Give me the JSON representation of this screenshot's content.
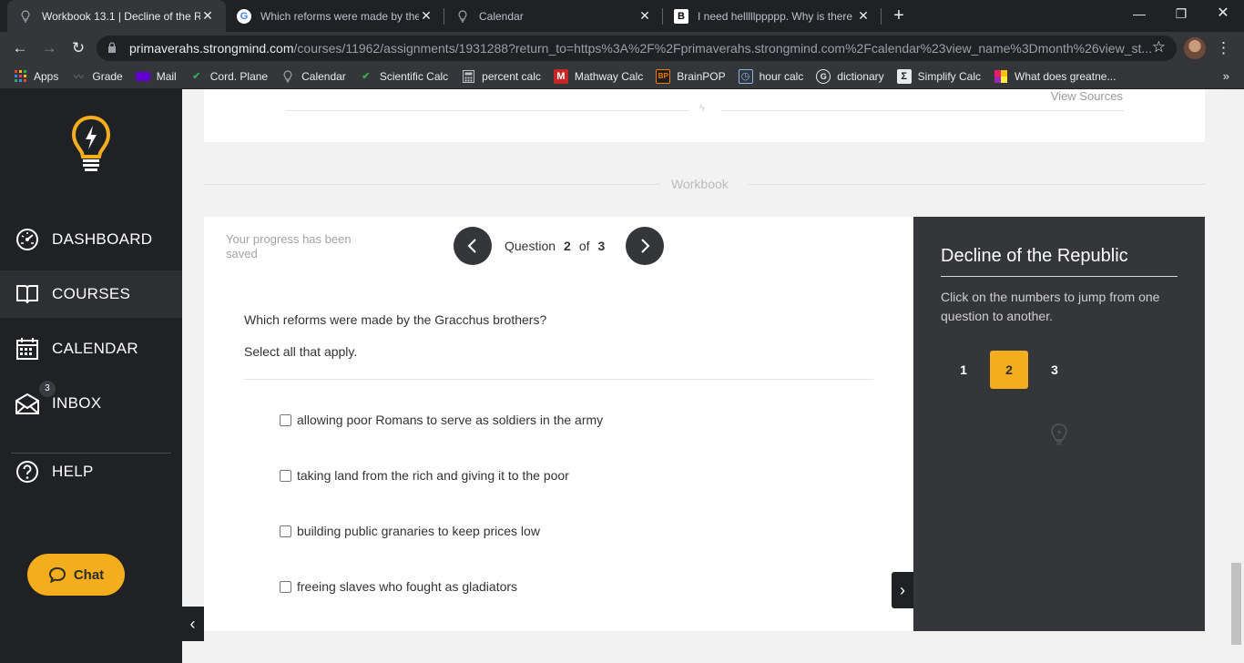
{
  "browser": {
    "tabs": [
      {
        "title": "Workbook 13.1 | Decline of the R",
        "icon": "lightbulb-icon",
        "active": true
      },
      {
        "title": "Which reforms were made by the",
        "icon": "google-icon",
        "active": false
      },
      {
        "title": "Calendar",
        "icon": "lightbulb-icon",
        "active": false
      },
      {
        "title": "I need helllllppppp. Why is there",
        "icon": "brainly-icon",
        "active": false
      }
    ],
    "url_host": "primaverahs.strongmind.com",
    "url_path": "/courses/11962/assignments/1931288?return_to=https%3A%2F%2Fprimaverahs.strongmind.com%2Fcalendar%23view_name%3Dmonth%26view_st...",
    "bookmarks": [
      {
        "label": "Apps",
        "icon": "apps-grid-icon",
        "color": "#ea4335"
      },
      {
        "label": "Grade",
        "icon": "grade-icon",
        "color": "#5f6368"
      },
      {
        "label": "Mail",
        "icon": "mail-icon",
        "color": "#6001d2"
      },
      {
        "label": "Cord. Plane",
        "icon": "check-icon",
        "color": "#34a853"
      },
      {
        "label": "Calendar",
        "icon": "lightbulb-icon",
        "color": "#9aa0a6"
      },
      {
        "label": "Scientific Calc",
        "icon": "check-icon",
        "color": "#34a853"
      },
      {
        "label": "percent calc",
        "icon": "calculator-icon",
        "color": "#9aa0a6"
      },
      {
        "label": "Mathway Calc",
        "icon": "mathway-icon",
        "color": "#c62828"
      },
      {
        "label": "BrainPOP",
        "icon": "brainpop-icon",
        "color": "#f57c00"
      },
      {
        "label": "hour calc",
        "icon": "clock-icon",
        "color": "#1a73e8"
      },
      {
        "label": "dictionary",
        "icon": "google-icon",
        "color": "#e8eaed"
      },
      {
        "label": "Simplify Calc",
        "icon": "symbolab-icon",
        "color": "#202124"
      },
      {
        "label": "What does greatne...",
        "icon": "bookmark-icon",
        "color": "#e91e63"
      }
    ]
  },
  "sidebar": {
    "items": [
      {
        "label": "DASHBOARD",
        "icon": "dashboard-gauge-icon",
        "active": false
      },
      {
        "label": "COURSES",
        "icon": "open-book-icon",
        "active": true
      },
      {
        "label": "CALENDAR",
        "icon": "calendar-icon",
        "active": false
      },
      {
        "label": "INBOX",
        "icon": "inbox-icon",
        "active": false,
        "badge": "3"
      },
      {
        "label": "HELP",
        "icon": "help-circle-icon",
        "active": false
      }
    ],
    "chat_label": "Chat",
    "accent": "#f4ad1d"
  },
  "content": {
    "view_sources": "View Sources",
    "section_label": "Workbook",
    "progress_saved": "Your progress has been saved",
    "question_label": "Question",
    "question_current": "2",
    "question_of": "of",
    "question_total": "3",
    "question_text": "Which reforms were made by the Gracchus brothers?",
    "question_sub": "Select all that apply.",
    "options": [
      "allowing poor Romans to serve as soldiers in the army",
      "taking land from the rich and giving it to the poor",
      "building public granaries to keep prices low",
      "freeing slaves who fought as gladiators"
    ]
  },
  "panel": {
    "title": "Decline of the Republic",
    "description": "Click on the numbers to jump from one question to another.",
    "numbers": [
      "1",
      "2",
      "3"
    ],
    "active_number": "2"
  }
}
